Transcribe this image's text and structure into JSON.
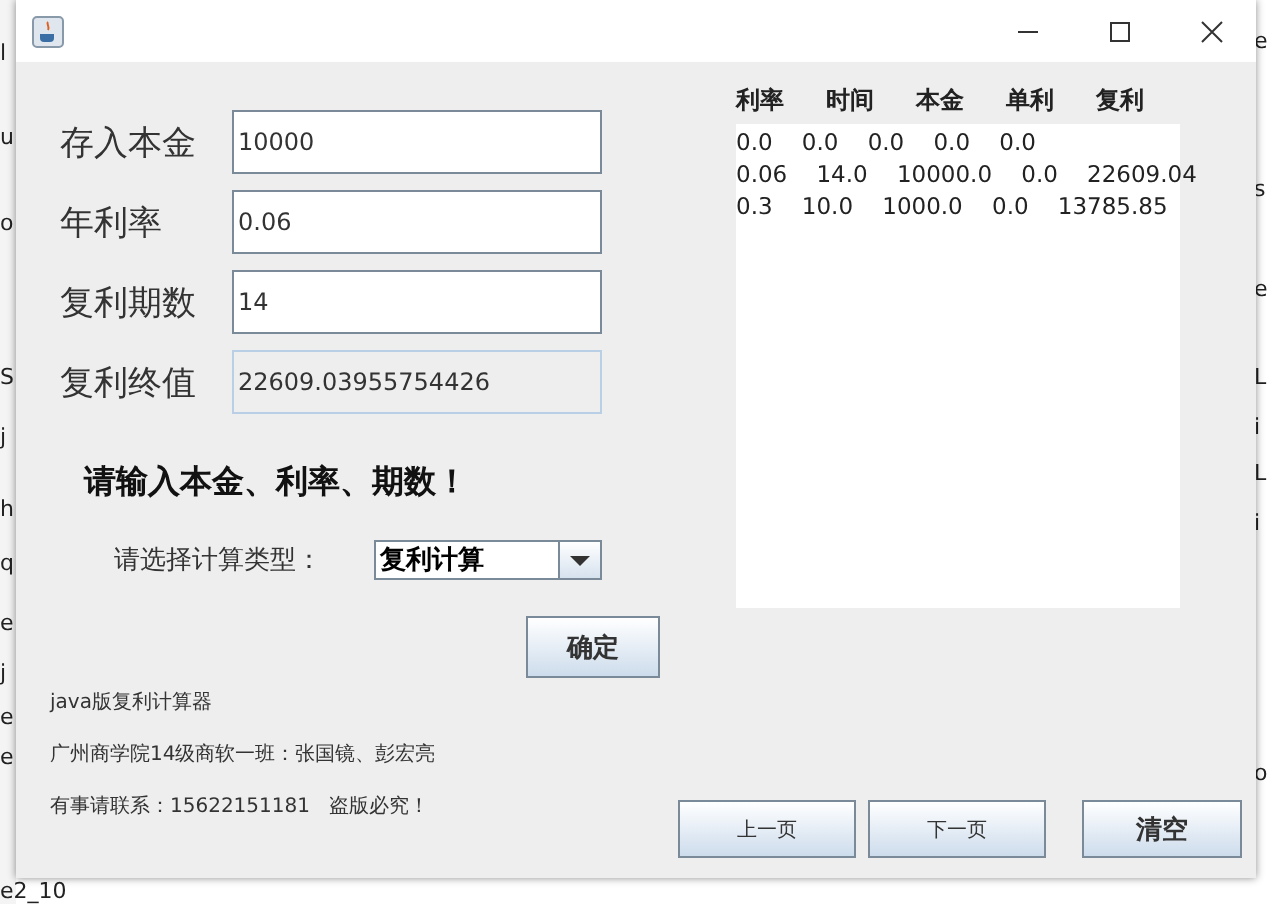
{
  "background": {
    "left_fragments": [
      "l",
      "u",
      "o",
      "S",
      "j",
      "h",
      "q",
      "e",
      "j",
      "e",
      "e",
      "e2_10"
    ],
    "right_fragments": [
      "e",
      "s",
      "e",
      "L",
      "i",
      "L",
      "i",
      "o"
    ]
  },
  "fields": [
    {
      "label": "存入本金",
      "value": "10000",
      "disabled": false
    },
    {
      "label": "年利率",
      "value": "0.06",
      "disabled": false
    },
    {
      "label": "复利期数",
      "value": "14",
      "disabled": false
    },
    {
      "label": "复利终值",
      "value": "22609.03955754426",
      "disabled": true
    }
  ],
  "prompt": "请输入本金、利率、期数！",
  "calc_type": {
    "label": "请选择计算类型：",
    "value": "复利计算"
  },
  "confirm_button": "确定",
  "footer": [
    "java版复利计算器",
    "广州商学院14级商软一班：张国镜、彭宏亮",
    "有事请联系：15622151181   盗版必究！"
  ],
  "results": {
    "columns": [
      "利率",
      "时间",
      "本金",
      "单利",
      "复利"
    ],
    "lines": [
      "0.0    0.0    0.0    0.0    0.0",
      "0.06    14.0    10000.0    0.0    22609.04",
      "0.3    10.0    1000.0    0.0    13785.85"
    ]
  },
  "buttons": [
    {
      "label": "上一页",
      "kind": "small"
    },
    {
      "label": "下一页",
      "kind": "small"
    },
    {
      "label": "清空",
      "kind": "bold"
    }
  ]
}
